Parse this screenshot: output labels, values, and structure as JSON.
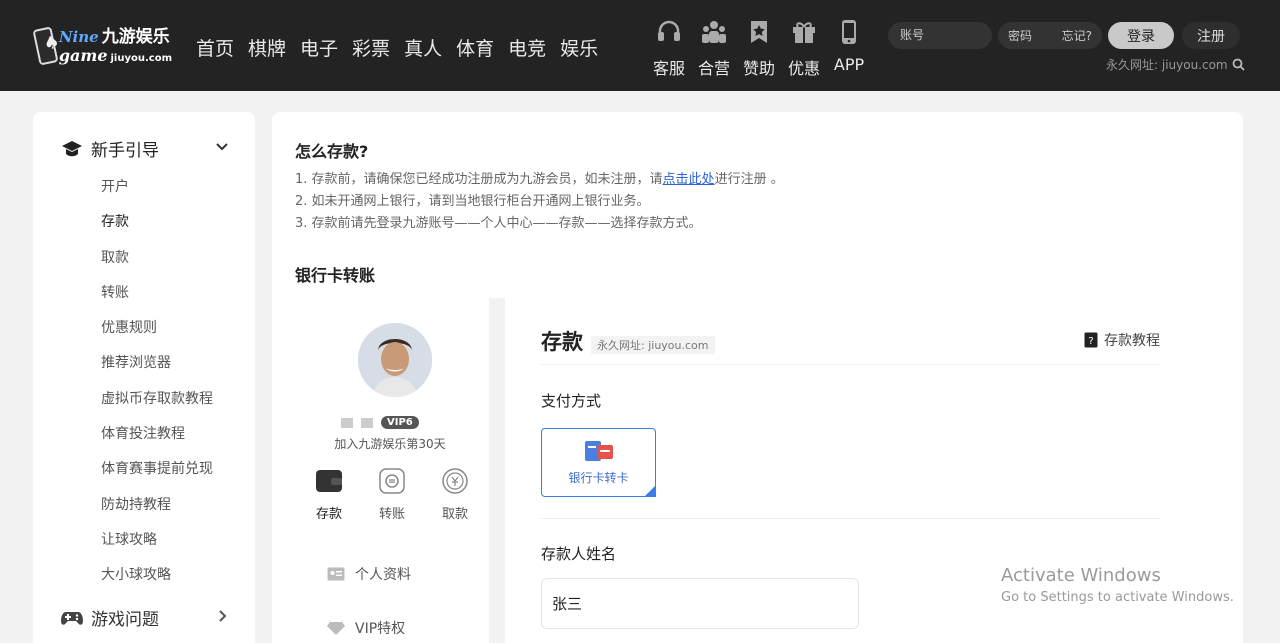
{
  "header": {
    "logo": {
      "nine": "Nine",
      "cn_name": "九游娱乐",
      "game": "game",
      "domain": "jiuyou.com"
    },
    "nav": [
      "首页",
      "棋牌",
      "电子",
      "彩票",
      "真人",
      "体育",
      "电竞",
      "娱乐"
    ],
    "quick_links": [
      {
        "label": "客服",
        "icon": "headset-icon"
      },
      {
        "label": "合营",
        "icon": "partners-icon"
      },
      {
        "label": "赞助",
        "icon": "bookmark-star-icon"
      },
      {
        "label": "优惠",
        "icon": "gift-icon"
      },
      {
        "label": "APP",
        "icon": "phone-icon"
      }
    ],
    "login": {
      "account_placeholder": "账号",
      "password_placeholder": "密码",
      "forgot": "忘记?",
      "login_btn": "登录",
      "register_btn": "注册"
    },
    "perm_url": "永久网址: jiuyou.com"
  },
  "sidebar": {
    "section1": {
      "title": "新手引导",
      "icon": "graduation-cap-icon"
    },
    "items": [
      "开户",
      "存款",
      "取款",
      "转账",
      "优惠规则",
      "推荐浏览器",
      "虚拟币存取款教程",
      "体育投注教程",
      "体育赛事提前兑现",
      "防劫持教程",
      "让球攻略",
      "大小球攻略"
    ],
    "active_index": 1,
    "section2": {
      "title": "游戏问题",
      "icon": "gamepad-icon"
    }
  },
  "main": {
    "title": "怎么存款?",
    "step1_pre": "1. 存款前，请确保您已经成功注册成为九游会员，如未注册，请",
    "step1_link": "点击此处",
    "step1_post": "进行注册 。",
    "step2": "2. 如未开通网上银行，请到当地银行柜台开通网上银行业务。",
    "step3": "3. 存款前请先登录九游账号——个人中心——存款——选择存款方式。",
    "subtitle": "银行卡转账"
  },
  "embed": {
    "user": {
      "vip": "VIP6",
      "joined": "加入九游娱乐第30天"
    },
    "wallet": [
      {
        "label": "存款",
        "icon": "wallet-icon"
      },
      {
        "label": "转账",
        "icon": "transfer-icon"
      },
      {
        "label": "取款",
        "icon": "withdraw-icon"
      }
    ],
    "menu": [
      {
        "label": "个人资料",
        "icon": "id-card-icon"
      },
      {
        "label": "VIP特权",
        "icon": "diamond-icon"
      }
    ],
    "deposit": {
      "title": "存款",
      "url": "永久网址: jiuyou.com",
      "tutorial": "存款教程",
      "pay_label": "支付方式",
      "pay_option": "银行卡转卡",
      "name_label": "存款人姓名",
      "name_value": "张三"
    }
  },
  "watermark": {
    "line1": "Activate Windows",
    "line2": "Go to Settings to activate Windows."
  }
}
